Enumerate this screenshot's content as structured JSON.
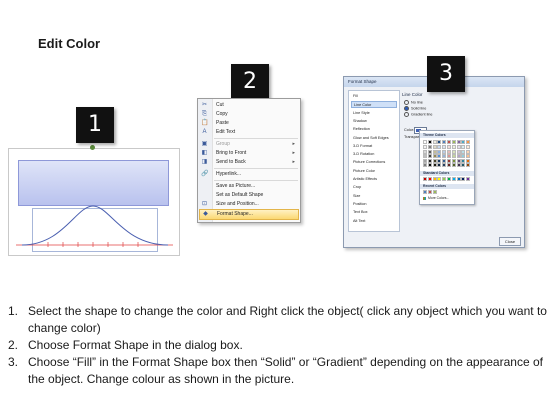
{
  "title": "Edit Color",
  "badges": [
    "1",
    "2",
    "3"
  ],
  "context_menu": {
    "items": [
      {
        "icon": "cut-icon",
        "glyph": "✂",
        "label": "Cut",
        "disabled": false,
        "submenu": false
      },
      {
        "icon": "copy-icon",
        "glyph": "⎘",
        "label": "Copy",
        "disabled": false,
        "submenu": false
      },
      {
        "icon": "paste-icon",
        "glyph": "📋",
        "label": "Paste",
        "disabled": false,
        "submenu": false
      },
      {
        "icon": "edit-text-icon",
        "glyph": "A",
        "label": "Edit Text",
        "disabled": false,
        "submenu": false
      },
      {
        "icon": "group-icon",
        "glyph": "▣",
        "label": "Group",
        "disabled": true,
        "submenu": true
      },
      {
        "icon": "bring-to-front-icon",
        "glyph": "◧",
        "label": "Bring to Front",
        "disabled": false,
        "submenu": true
      },
      {
        "icon": "send-to-back-icon",
        "glyph": "◨",
        "label": "Send to Back",
        "disabled": false,
        "submenu": true
      },
      {
        "icon": "hyperlink-icon",
        "glyph": "🔗",
        "label": "Hyperlink...",
        "disabled": false,
        "submenu": false
      },
      {
        "icon": "save-as-picture-icon",
        "glyph": "",
        "label": "Save as Picture...",
        "disabled": false,
        "submenu": false
      },
      {
        "icon": "set-default-shape-icon",
        "glyph": "",
        "label": "Set as Default Shape",
        "disabled": false,
        "submenu": false
      },
      {
        "icon": "size-position-icon",
        "glyph": "⊡",
        "label": "Size and Position...",
        "disabled": false,
        "submenu": false
      },
      {
        "icon": "format-shape-icon",
        "glyph": "◆",
        "label": "Format Shape...",
        "disabled": false,
        "submenu": false,
        "highlighted": true
      }
    ]
  },
  "format_dialog": {
    "title": "Format Shape",
    "categories": [
      "Fill",
      "Line Color",
      "Line Style",
      "Shadow",
      "Reflection",
      "Glow and Soft Edges",
      "3-D Format",
      "3-D Rotation",
      "Picture Corrections",
      "Picture Color",
      "Artistic Effects",
      "Crop",
      "Size",
      "Position",
      "Text Box",
      "Alt Text"
    ],
    "selected_category": "Line Color",
    "section_title": "Line Color",
    "options": [
      "No line",
      "Solid line",
      "Gradient line"
    ],
    "selected_option": "Solid line",
    "color_label": "Color:",
    "transparency_label": "Transparency:",
    "close_label": "Close",
    "palette": {
      "theme_header": "Theme Colors",
      "standard_header": "Standard Colors",
      "recent_header": "Recent Colors",
      "more_label": "More Colors...",
      "theme_top": [
        "#ffffff",
        "#000000",
        "#eeece1",
        "#1f497d",
        "#4f81bd",
        "#c0504d",
        "#9bbb59",
        "#8064a2",
        "#4bacc6",
        "#f79646"
      ],
      "theme_shades": [
        [
          "#f2f2f2",
          "#7f7f7f",
          "#ddd9c3",
          "#c6d9f0",
          "#dbe5f1",
          "#f2dcdb",
          "#ebf1dd",
          "#e5e0ec",
          "#dbeef3",
          "#fdeada"
        ],
        [
          "#d8d8d8",
          "#595959",
          "#c4bd97",
          "#8db3e2",
          "#b8cce4",
          "#e5b9b7",
          "#d7e3bc",
          "#ccc1d9",
          "#b7dde8",
          "#fbd5b5"
        ],
        [
          "#bfbfbf",
          "#3f3f3f",
          "#938953",
          "#548dd4",
          "#95b3d7",
          "#d99694",
          "#c3d69b",
          "#b2a2c7",
          "#92cddc",
          "#fac08f"
        ],
        [
          "#a5a5a5",
          "#262626",
          "#494429",
          "#17365d",
          "#366092",
          "#953734",
          "#76923c",
          "#5f497a",
          "#31859b",
          "#e36c09"
        ],
        [
          "#7f7f7f",
          "#0c0c0c",
          "#1d1b10",
          "#0f243e",
          "#244061",
          "#632423",
          "#4f6128",
          "#3f3151",
          "#205867",
          "#974806"
        ]
      ],
      "standard": [
        "#c00000",
        "#ff0000",
        "#ffc000",
        "#ffff00",
        "#92d050",
        "#00b050",
        "#00b0f0",
        "#0070c0",
        "#002060",
        "#7030a0"
      ],
      "recent": [
        "#4f81bd",
        "#c0504d",
        "#9bbb59"
      ]
    }
  },
  "steps": [
    {
      "num": "1.",
      "text": "Select the shape to change the color and Right click the object( click any object which you want to change color)"
    },
    {
      "num": "2.",
      "text": "Choose Format Shape in the dialog box."
    },
    {
      "num": "3.",
      "text": "Choose “Fill” in the Format Shape box then “Solid” or “Gradient” depending on the appearance of the object. Change colour as shown in the picture."
    }
  ],
  "colors": {
    "shape_fill": "#c3caf0",
    "curve": "#4a5fb0",
    "axis": "#e04040",
    "highlight": "#fbd873"
  }
}
